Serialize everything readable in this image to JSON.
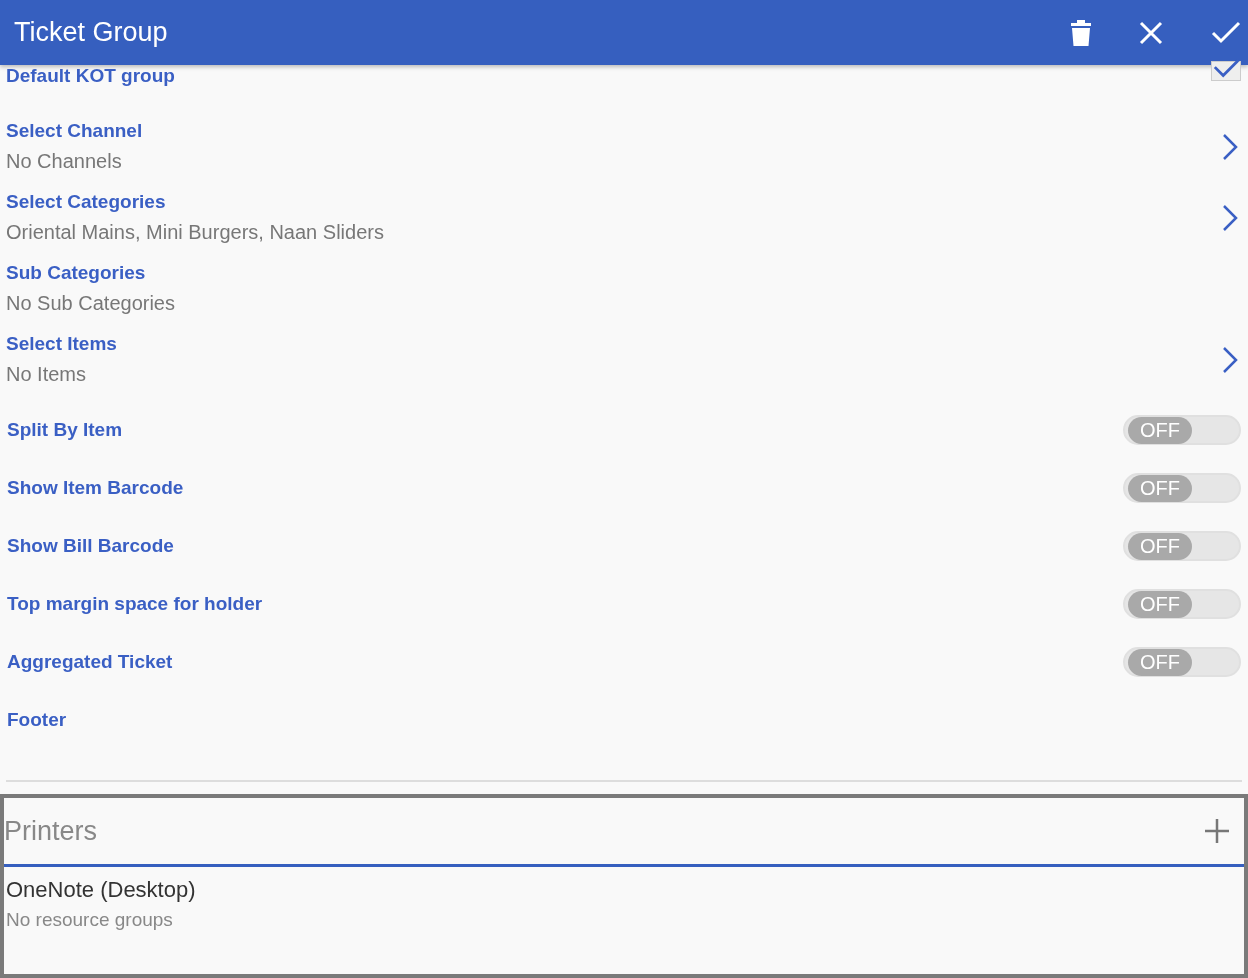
{
  "header": {
    "title": "Ticket Group"
  },
  "rows": [
    {
      "kind": "check",
      "label": "Default KOT group",
      "checked": true
    },
    {
      "kind": "link",
      "label": "Select Channel",
      "value": "No Channels",
      "chevron": true
    },
    {
      "kind": "link",
      "label": "Select Categories",
      "value": "Oriental Mains, Mini Burgers, Naan Sliders",
      "chevron": true
    },
    {
      "kind": "link",
      "label": "Sub Categories",
      "value": "No Sub Categories",
      "chevron": false
    },
    {
      "kind": "link",
      "label": "Select Items",
      "value": "No Items",
      "chevron": true
    },
    {
      "kind": "toggle",
      "label": "Split By Item",
      "on": false,
      "state_text": "OFF"
    },
    {
      "kind": "toggle",
      "label": "Show Item Barcode",
      "on": false,
      "state_text": "OFF"
    },
    {
      "kind": "toggle",
      "label": "Show Bill Barcode",
      "on": false,
      "state_text": "OFF"
    },
    {
      "kind": "toggle",
      "label": "Top margin space for holder",
      "on": false,
      "state_text": "OFF"
    },
    {
      "kind": "toggle",
      "label": "Aggregated Ticket",
      "on": false,
      "state_text": "OFF"
    },
    {
      "kind": "plain",
      "label": "Footer"
    }
  ],
  "printers": {
    "title": "Printers",
    "items": [
      {
        "name": "OneNote (Desktop)",
        "detail": "No resource groups"
      }
    ]
  }
}
